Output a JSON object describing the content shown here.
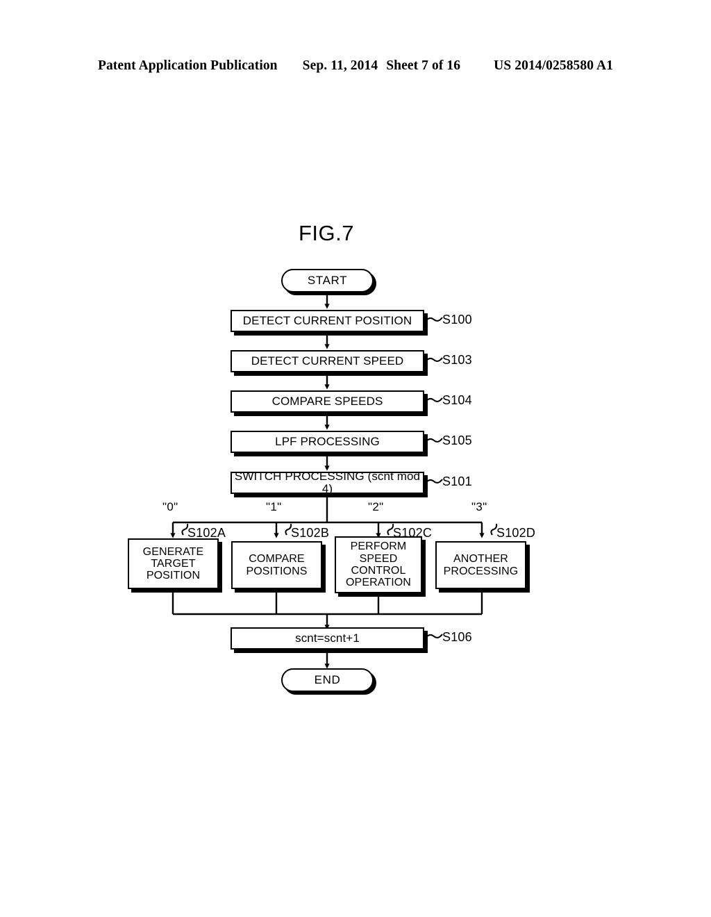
{
  "header": {
    "publication": "Patent Application Publication",
    "date": "Sep. 11, 2014",
    "sheet": "Sheet 7 of 16",
    "patent_number": "US 2014/0258580 A1"
  },
  "figure": {
    "title": "FIG.7"
  },
  "flowchart": {
    "start": {
      "label": "START"
    },
    "end": {
      "label": "END"
    },
    "steps": [
      {
        "id": "S100",
        "label": "DETECT CURRENT POSITION",
        "ref": "S100"
      },
      {
        "id": "S103",
        "label": "DETECT CURRENT SPEED",
        "ref": "S103"
      },
      {
        "id": "S104",
        "label": "COMPARE SPEEDS",
        "ref": "S104"
      },
      {
        "id": "S105",
        "label": "LPF PROCESSING",
        "ref": "S105"
      },
      {
        "id": "S101",
        "label": "SWITCH PROCESSING (scnt mod 4)",
        "ref": "S101"
      },
      {
        "id": "S106",
        "label": "scnt=scnt+1",
        "ref": "S106"
      }
    ],
    "branches": [
      {
        "case": "\"0\"",
        "ref": "S102A",
        "lines": [
          "GENERATE",
          "TARGET",
          "POSITION"
        ]
      },
      {
        "case": "\"1\"",
        "ref": "S102B",
        "lines": [
          "COMPARE",
          "POSITIONS"
        ]
      },
      {
        "case": "\"2\"",
        "ref": "S102C",
        "lines": [
          "PERFORM",
          "SPEED",
          "CONTROL",
          "OPERATION"
        ]
      },
      {
        "case": "\"3\"",
        "ref": "S102D",
        "lines": [
          "ANOTHER",
          "PROCESSING"
        ]
      }
    ]
  },
  "colors": {
    "ink": "#000000",
    "paper": "#ffffff"
  }
}
